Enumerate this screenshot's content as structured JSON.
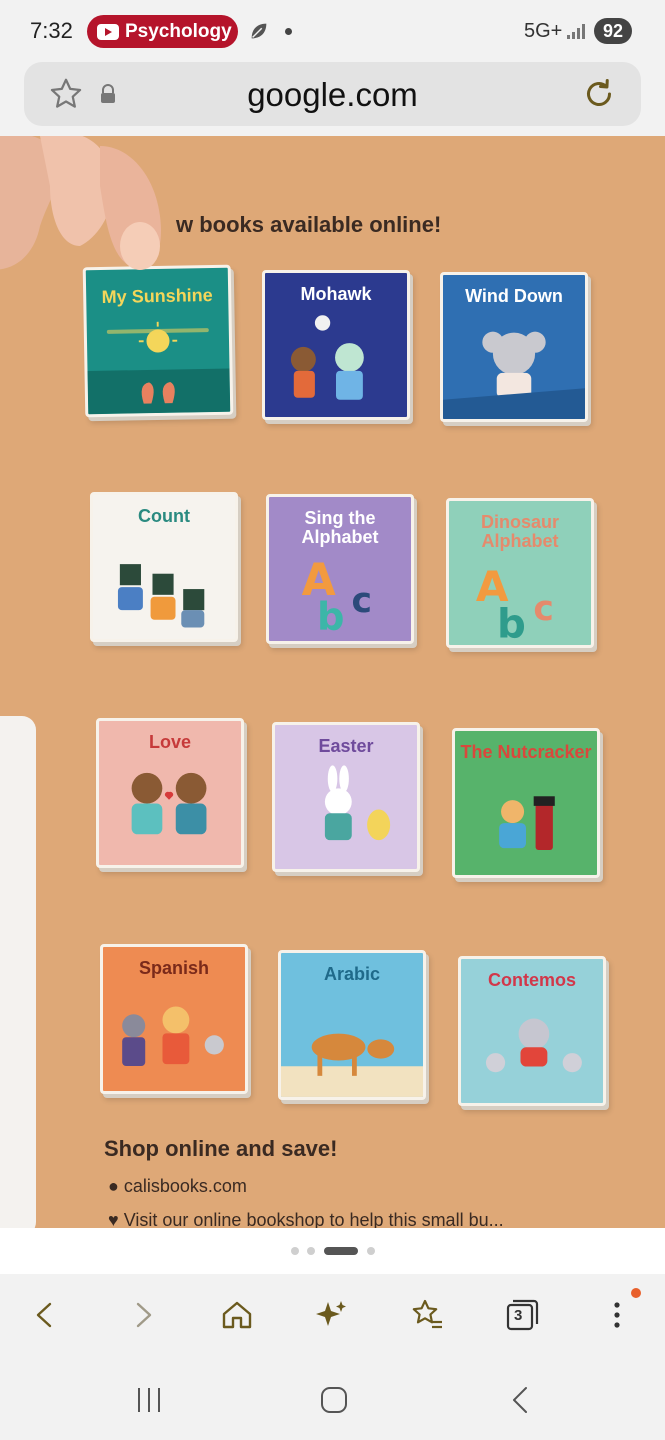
{
  "status_bar": {
    "time": "7:32",
    "notification_app": "Psychology",
    "network": "5G+",
    "battery": "92"
  },
  "browser": {
    "url": "google.com"
  },
  "page": {
    "headline": "w books available online!",
    "books": [
      {
        "title": "My Sunshine",
        "bg": "#1b8f86",
        "text_color": "#f4d65a"
      },
      {
        "title": "Mohawk",
        "bg": "#2c3a8f",
        "text_color": "#ffffff"
      },
      {
        "title": "Wind Down",
        "bg": "#2f6fb2",
        "text_color": "#ffffff"
      },
      {
        "title": "Count",
        "bg": "#f6f3ee",
        "text_color": "#2a8a80"
      },
      {
        "title": "Sing the Alphabet",
        "bg": "#a28ac8",
        "text_color": "#ffffff"
      },
      {
        "title": "Dinosaur Alphabet",
        "bg": "#8fd0ba",
        "text_color": "#e58a6c"
      },
      {
        "title": "Love",
        "bg": "#f0b8ad",
        "text_color": "#c63a3a"
      },
      {
        "title": "Easter",
        "bg": "#d8c6e6",
        "text_color": "#6f4b9c"
      },
      {
        "title": "The Nutcracker",
        "bg": "#57b36b",
        "text_color": "#d9483c"
      },
      {
        "title": "Spanish",
        "bg": "#ee8b52",
        "text_color": "#7a2a1a"
      },
      {
        "title": "Arabic",
        "bg": "#6fc0de",
        "text_color": "#1f6a8a"
      },
      {
        "title": "Contemos",
        "bg": "#96d1d9",
        "text_color": "#d2374a"
      }
    ],
    "shop_title": "Shop online and save!",
    "shop_link": "calisbooks.com",
    "shop_visit": "Visit our online bookshop to help this small bu..."
  },
  "toolbar": {
    "tabs_count": "3"
  },
  "colors": {
    "page_bg": "#dea877",
    "youtube_red": "#b5142b",
    "toolbar_icon": "#6b5a1e"
  }
}
